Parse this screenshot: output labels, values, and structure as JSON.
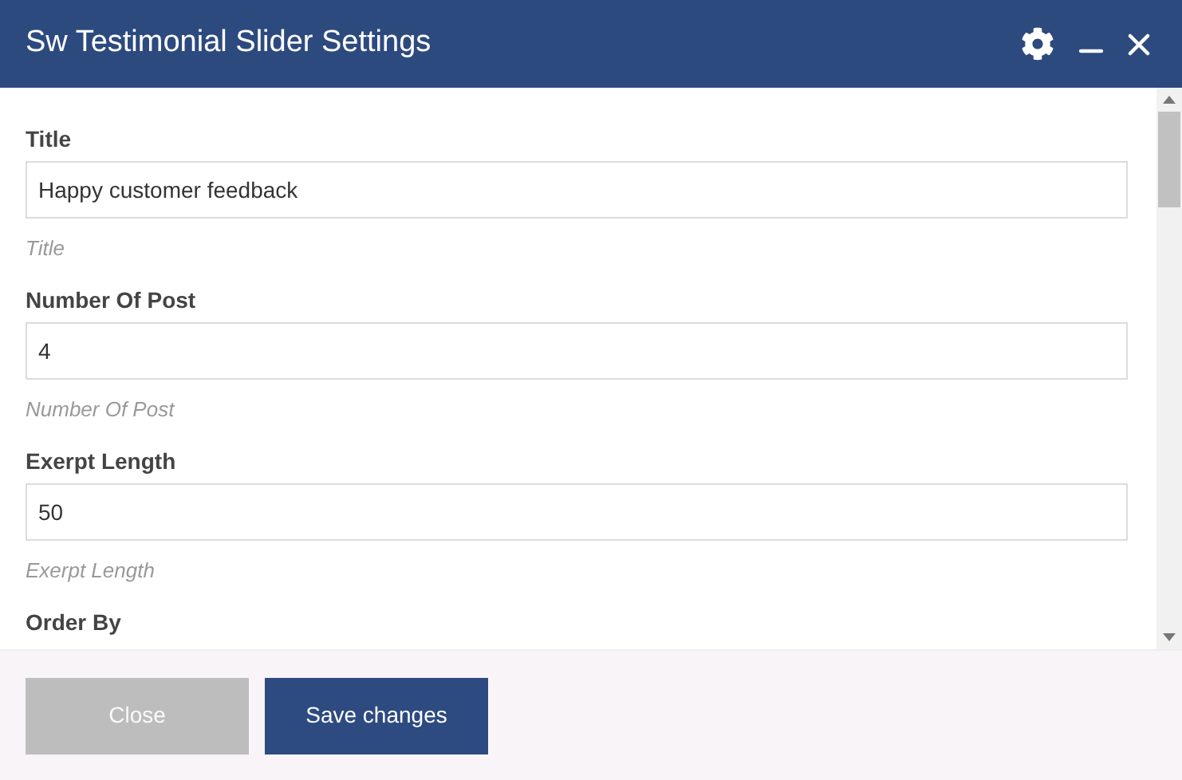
{
  "window": {
    "title": "Sw Testimonial Slider Settings"
  },
  "fields": [
    {
      "label": "Title",
      "value": "Happy customer feedback",
      "help": "Title"
    },
    {
      "label": "Number Of Post",
      "value": "4",
      "help": "Number Of Post"
    },
    {
      "label": "Exerpt Length",
      "value": "50",
      "help": "Exerpt Length"
    },
    {
      "label": "Order By"
    }
  ],
  "buttons": [
    {
      "label": "Close",
      "kind": "secondary"
    },
    {
      "label": "Save changes",
      "kind": "primary"
    }
  ]
}
